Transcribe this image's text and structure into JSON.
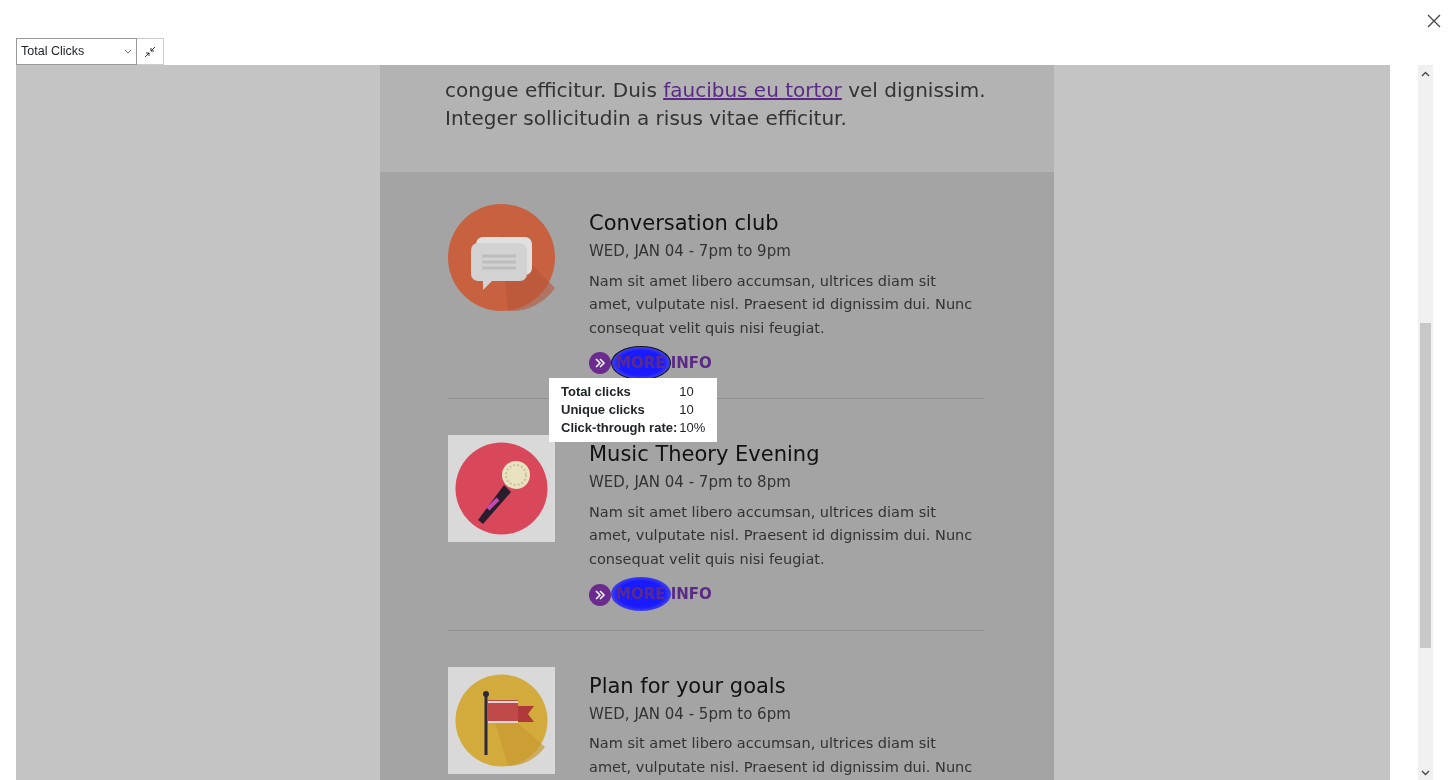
{
  "toolbar": {
    "metric_select": {
      "value": "Total Clicks"
    }
  },
  "intro": {
    "link_text": "faucibus eu tortor",
    "before_link": "congue efficitur. Duis",
    "after_link": "vel dignissim. Integer sollicitudin a risus vitae efficitur."
  },
  "events": [
    {
      "kind": "chat",
      "framed": false,
      "title": "Conversation club",
      "when": "WED, JAN 04 - 7pm to 9pm",
      "description": "Nam sit amet libero accumsan, ultrices diam sit amet, vulputate nisl. Praesent id dignissim dui. Nunc consequat velit quis nisi feugiat.",
      "link": "MORE INFO",
      "hovered": true
    },
    {
      "kind": "microphone",
      "framed": true,
      "title": "Music Theory Evening",
      "when": "WED, JAN 04 - 7pm to 8pm",
      "description": "Nam sit amet libero accumsan, ultrices diam sit amet, vulputate nisl. Praesent id dignissim dui. Nunc consequat velit quis nisi feugiat.",
      "link": "MORE INFO",
      "hovered": false
    },
    {
      "kind": "flag",
      "framed": true,
      "title": "Plan for your goals",
      "when": "WED, JAN 04 - 5pm to 6pm",
      "description": "Nam sit amet libero accumsan, ultrices diam sit amet, vulputate nisl. Praesent id dignissim dui. Nunc"
    }
  ],
  "tooltip": {
    "rows": [
      {
        "label": "Total clicks",
        "value": "10"
      },
      {
        "label": "Unique clicks",
        "value": "10"
      },
      {
        "label": "Click-through rate:",
        "value": "10%"
      }
    ]
  }
}
